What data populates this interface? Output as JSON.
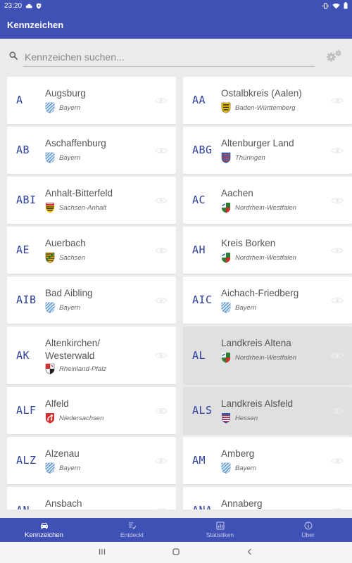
{
  "status_bar": {
    "time": "23:20"
  },
  "app_title": "Kennzeichen",
  "search": {
    "placeholder": "Kennzeichen suchen..."
  },
  "cards": [
    {
      "code": "A",
      "city": "Augsburg",
      "state": "Bayern",
      "coat": "bayern",
      "highlighted": false
    },
    {
      "code": "AA",
      "city": "Ostalbkreis (Aalen)",
      "state": "Baden-Württemberg",
      "coat": "bw",
      "highlighted": false
    },
    {
      "code": "AB",
      "city": "Aschaffenburg",
      "state": "Bayern",
      "coat": "bayern",
      "highlighted": false
    },
    {
      "code": "ABG",
      "city": "Altenburger Land",
      "state": "Thüringen",
      "coat": "thueringen",
      "highlighted": false
    },
    {
      "code": "ABI",
      "city": "Anhalt-Bitterfeld",
      "state": "Sachsen-Anhalt",
      "coat": "sachsen-anhalt",
      "highlighted": false
    },
    {
      "code": "AC",
      "city": "Aachen",
      "state": "Nordrhein-Westfalen",
      "coat": "nrw",
      "highlighted": false
    },
    {
      "code": "AE",
      "city": "Auerbach",
      "state": "Sachsen",
      "coat": "sachsen",
      "highlighted": false
    },
    {
      "code": "AH",
      "city": "Kreis Borken",
      "state": "Nordrhein-Westfalen",
      "coat": "nrw",
      "highlighted": false
    },
    {
      "code": "AIB",
      "city": "Bad Aibling",
      "state": "Bayern",
      "coat": "bayern",
      "highlighted": false
    },
    {
      "code": "AIC",
      "city": "Aichach-Friedberg",
      "state": "Bayern",
      "coat": "bayern",
      "highlighted": false
    },
    {
      "code": "AK",
      "city": "Altenkirchen/ Westerwald",
      "state": "Rheinland-Pfalz",
      "coat": "rlp",
      "highlighted": false
    },
    {
      "code": "AL",
      "city": "Landkreis Altena",
      "state": "Nordrhein-Westfalen",
      "coat": "nrw",
      "highlighted": true
    },
    {
      "code": "ALF",
      "city": "Alfeld",
      "state": "Niedersachsen",
      "coat": "niedersachsen",
      "highlighted": false
    },
    {
      "code": "ALS",
      "city": "Landkreis Alsfeld",
      "state": "Hessen",
      "coat": "hessen",
      "highlighted": true
    },
    {
      "code": "ALZ",
      "city": "Alzenau",
      "state": "Bayern",
      "coat": "bayern",
      "highlighted": false
    },
    {
      "code": "AM",
      "city": "Amberg",
      "state": "Bayern",
      "coat": "bayern",
      "highlighted": false
    },
    {
      "code": "AN",
      "city": "Ansbach",
      "state": "",
      "coat": "",
      "highlighted": false
    },
    {
      "code": "ANA",
      "city": "Annaberg",
      "state": "",
      "coat": "",
      "highlighted": false
    }
  ],
  "bottom_nav": [
    {
      "label": "Kennzeichen",
      "icon": "car-icon",
      "active": true
    },
    {
      "label": "Entdeckt",
      "icon": "check-list-icon",
      "active": false
    },
    {
      "label": "Statistiken",
      "icon": "bar-chart-icon",
      "active": false
    },
    {
      "label": "Über",
      "icon": "info-icon",
      "active": false
    }
  ],
  "colors": {
    "primary": "#3f51b5",
    "code_text": "#2e3f9e",
    "highlight": "#e0e0e0",
    "background": "#ebebeb"
  }
}
